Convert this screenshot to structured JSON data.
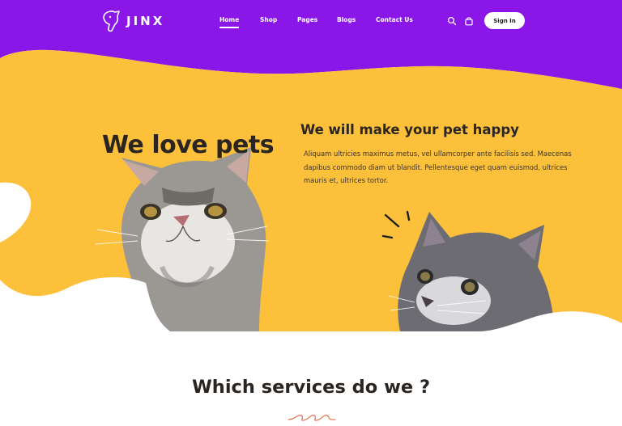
{
  "colors": {
    "purple": "#8a16e8",
    "yellow": "#fcc03b",
    "cat_grey": "#8f8d8a",
    "cat_dark": "#5a5a60",
    "text_dark": "#2a2520",
    "accent_swirl": "#e87a56"
  },
  "header": {
    "logo_text": "JINX",
    "nav": [
      {
        "label": "Home",
        "active": true
      },
      {
        "label": "Shop",
        "active": false
      },
      {
        "label": "Pages",
        "active": false
      },
      {
        "label": "Blogs",
        "active": false
      },
      {
        "label": "Contact Us",
        "active": false
      }
    ],
    "icons": [
      "search-icon",
      "cart-bag-icon"
    ],
    "signin_label": "Sign In"
  },
  "hero": {
    "title": "We love pets",
    "subtitle": "We will make your pet happy",
    "body": "Aliquam ultricies maximus metus, vel ullamcorper ante facilisis sed. Maecenas dapibus commodo diam ut blandit. Pellentesque eget quam euismod, ultrices mauris et, ultrices tortor."
  },
  "services": {
    "title": "Which services do we ?"
  }
}
